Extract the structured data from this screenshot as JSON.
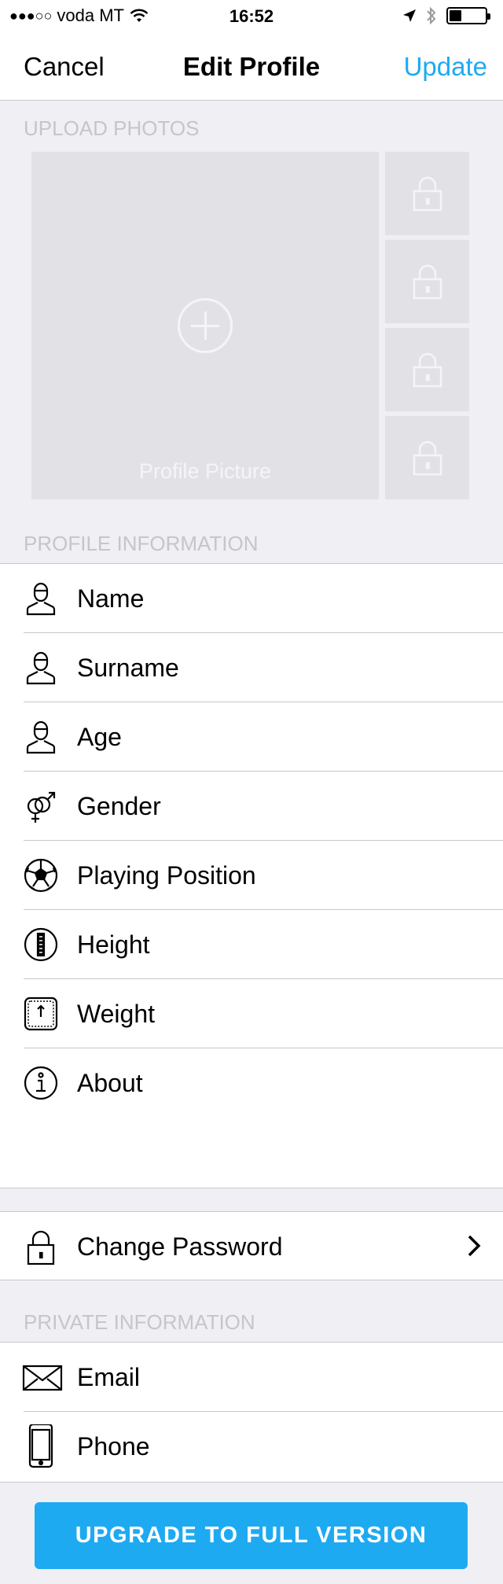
{
  "status_bar": {
    "carrier": "voda MT",
    "time": "16:52",
    "battery_level": 0.35
  },
  "nav": {
    "cancel_label": "Cancel",
    "title": "Edit Profile",
    "update_label": "Update"
  },
  "photos": {
    "section_title": "UPLOAD PHOTOS",
    "main_caption": "Profile Picture",
    "locked_slots": 4
  },
  "profile": {
    "section_title": "PROFILE INFORMATION",
    "items": [
      {
        "label": "Name",
        "icon": "person-icon"
      },
      {
        "label": "Surname",
        "icon": "person-icon"
      },
      {
        "label": "Age",
        "icon": "person-icon"
      },
      {
        "label": "Gender",
        "icon": "gender-icon"
      },
      {
        "label": "Playing Position",
        "icon": "soccer-ball-icon"
      },
      {
        "label": "Height",
        "icon": "ruler-icon"
      },
      {
        "label": "Weight",
        "icon": "scale-icon"
      },
      {
        "label": "About",
        "icon": "info-icon"
      }
    ]
  },
  "password": {
    "label": "Change Password",
    "icon": "lock-icon"
  },
  "private": {
    "section_title": "PRIVATE INFORMATION",
    "items": [
      {
        "label": "Email",
        "icon": "envelope-icon"
      },
      {
        "label": "Phone",
        "icon": "phone-icon"
      }
    ]
  },
  "upgrade": {
    "label": "UPGRADE TO FULL VERSION"
  },
  "colors": {
    "accent": "#1eaaf1",
    "background": "#efeff4",
    "separator": "#c8c7cc",
    "placeholder": "#e2e2e6"
  }
}
